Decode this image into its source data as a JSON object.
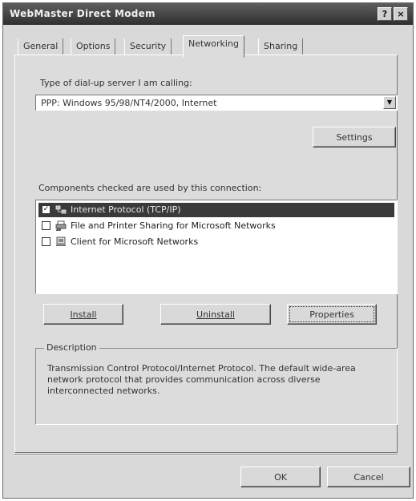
{
  "window": {
    "title": "WebMaster Direct Modem"
  },
  "titlebar": {
    "help_button": "?",
    "close_button": "×"
  },
  "tabs": [
    {
      "label": "General"
    },
    {
      "label": "Options"
    },
    {
      "label": "Security"
    },
    {
      "label": "Networking"
    },
    {
      "label": "Sharing"
    }
  ],
  "networking": {
    "server_type_label": "Type of dial-up server I am calling:",
    "server_type_value": "PPP: Windows 95/98/NT4/2000, Internet",
    "settings_button": "Settings",
    "components_label": "Components checked are used by this connection:",
    "components": [
      {
        "label": "Internet Protocol (TCP/IP)",
        "checked": true,
        "selected": true,
        "icon": "protocol-icon"
      },
      {
        "label": "File and Printer Sharing for Microsoft Networks",
        "checked": false,
        "selected": false,
        "icon": "printer-sharing-icon"
      },
      {
        "label": "Client for Microsoft Networks",
        "checked": false,
        "selected": false,
        "icon": "network-client-icon"
      }
    ],
    "install_button": "Install",
    "uninstall_button": "Uninstall",
    "properties_button": "Properties",
    "description_legend": "Description",
    "description_text": "Transmission Control Protocol/Internet Protocol. The default wide-area network protocol that provides communication across diverse interconnected networks."
  },
  "footer": {
    "ok_button": "OK",
    "cancel_button": "Cancel"
  },
  "colors": {
    "selection": "#3a3a3a",
    "titlebar": "#303030",
    "face": "#d9d9d9"
  }
}
